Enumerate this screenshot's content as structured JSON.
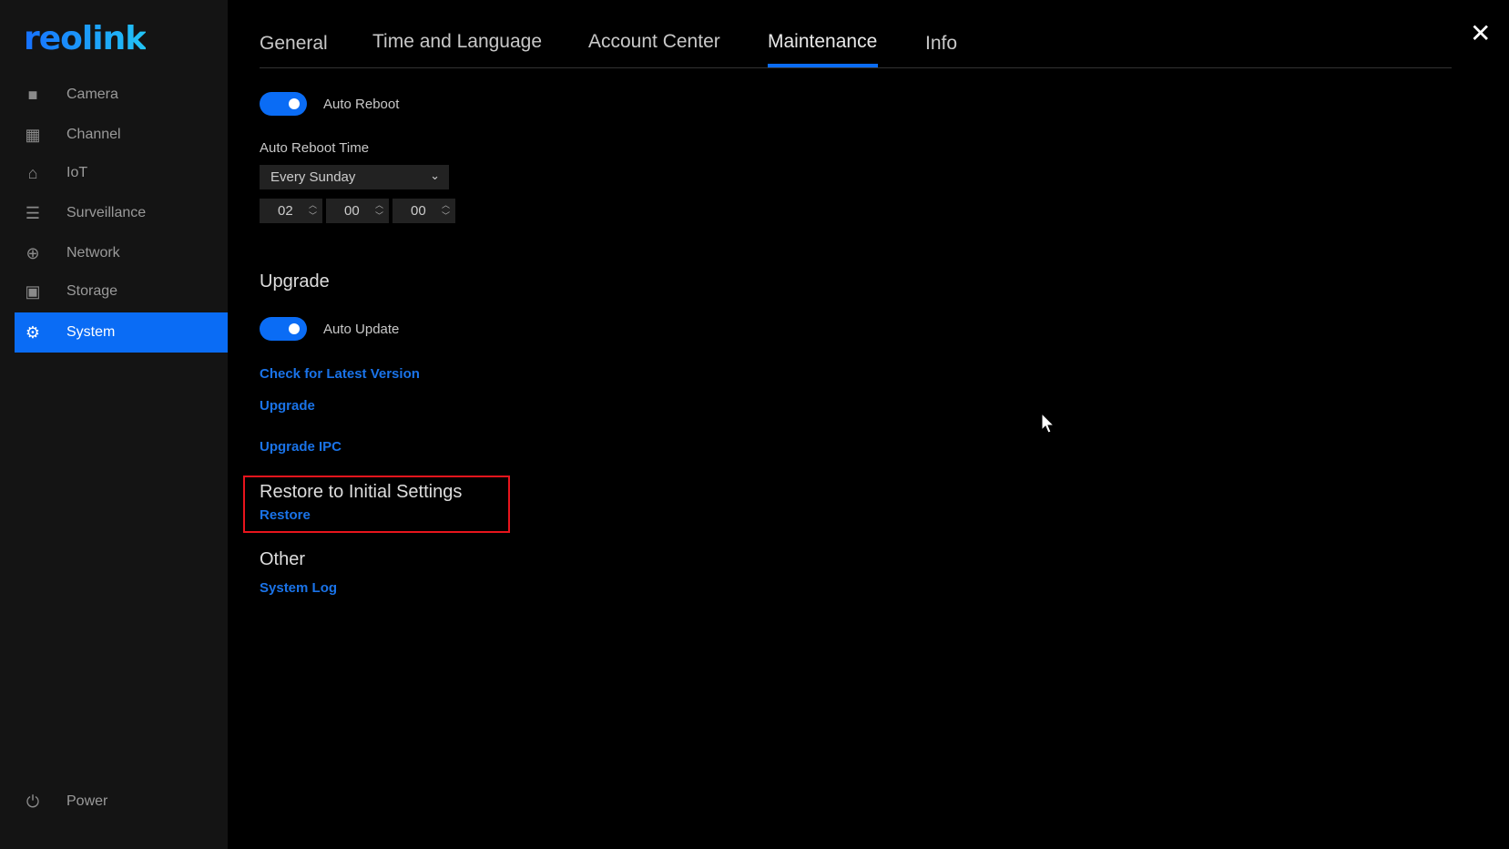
{
  "brand": {
    "logo": "reolink"
  },
  "sidebar": {
    "items": [
      {
        "label": "Camera",
        "icon": "camera-icon"
      },
      {
        "label": "Channel",
        "icon": "grid-icon"
      },
      {
        "label": "IoT",
        "icon": "home-icon"
      },
      {
        "label": "Surveillance",
        "icon": "list-icon"
      },
      {
        "label": "Network",
        "icon": "globe-icon"
      },
      {
        "label": "Storage",
        "icon": "storage-icon"
      },
      {
        "label": "System",
        "icon": "gear-icon",
        "active": true
      }
    ],
    "power": "Power"
  },
  "tabs": [
    "General",
    "Time and Language",
    "Account Center",
    "Maintenance",
    "Info"
  ],
  "active_tab": "Maintenance",
  "accent": "#0a6cf5",
  "reboot": {
    "toggle_label": "Auto Reboot",
    "enabled": true,
    "time_label": "Auto Reboot Time",
    "schedule": "Every Sunday",
    "hour": "02",
    "minute": "00",
    "second": "00"
  },
  "upgrade": {
    "heading": "Upgrade",
    "toggle_label": "Auto Update",
    "enabled": true,
    "check": "Check for Latest Version",
    "upgrade": "Upgrade",
    "upgrade_ipc": "Upgrade IPC"
  },
  "restore": {
    "heading": "Restore to Initial Settings",
    "link": "Restore"
  },
  "other": {
    "heading": "Other",
    "system_log": "System Log"
  }
}
